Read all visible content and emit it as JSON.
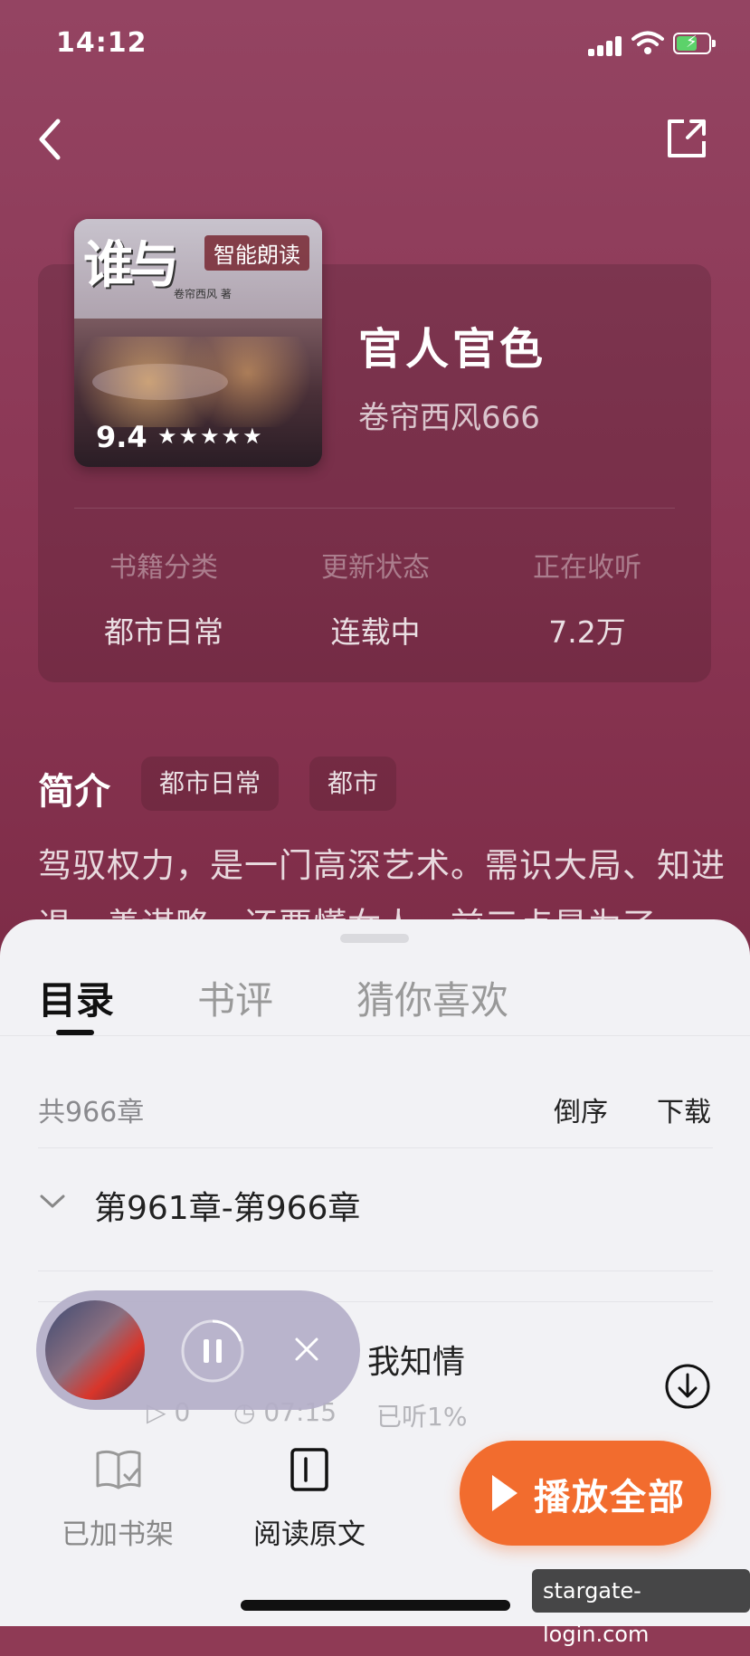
{
  "status": {
    "time": "14:12"
  },
  "book": {
    "cover_title": "谁与",
    "cover_author": "卷帘西风 著",
    "badge": "智能朗读",
    "score": "9.4",
    "stars": "★★★★★",
    "title": "官人官色",
    "author": "卷帘西风666"
  },
  "stats": [
    {
      "label": "书籍分类",
      "value": "都市日常"
    },
    {
      "label": "更新状态",
      "value": "连载中"
    },
    {
      "label": "正在收听",
      "value": "7.2万"
    }
  ],
  "intro": {
    "heading": "简介",
    "tags": [
      "都市日常",
      "都市"
    ],
    "text": "驾驭权力，是一门高深艺术。需识大局、知进退、善谋略，还要懂女人。前三点是为了"
  },
  "tabs": [
    "目录",
    "书评",
    "猜你喜欢"
  ],
  "catalog": {
    "count": "共966章",
    "sort": "倒序",
    "download": "下载",
    "range": "第961章-第966章",
    "chapter_title": "我知情",
    "plays": "0",
    "duration": "07:15",
    "progress": "已听1%"
  },
  "bottom": {
    "shelf": "已加书架",
    "read": "阅读原文",
    "play_all": "播放全部"
  },
  "watermark": "stargate-login.com"
}
